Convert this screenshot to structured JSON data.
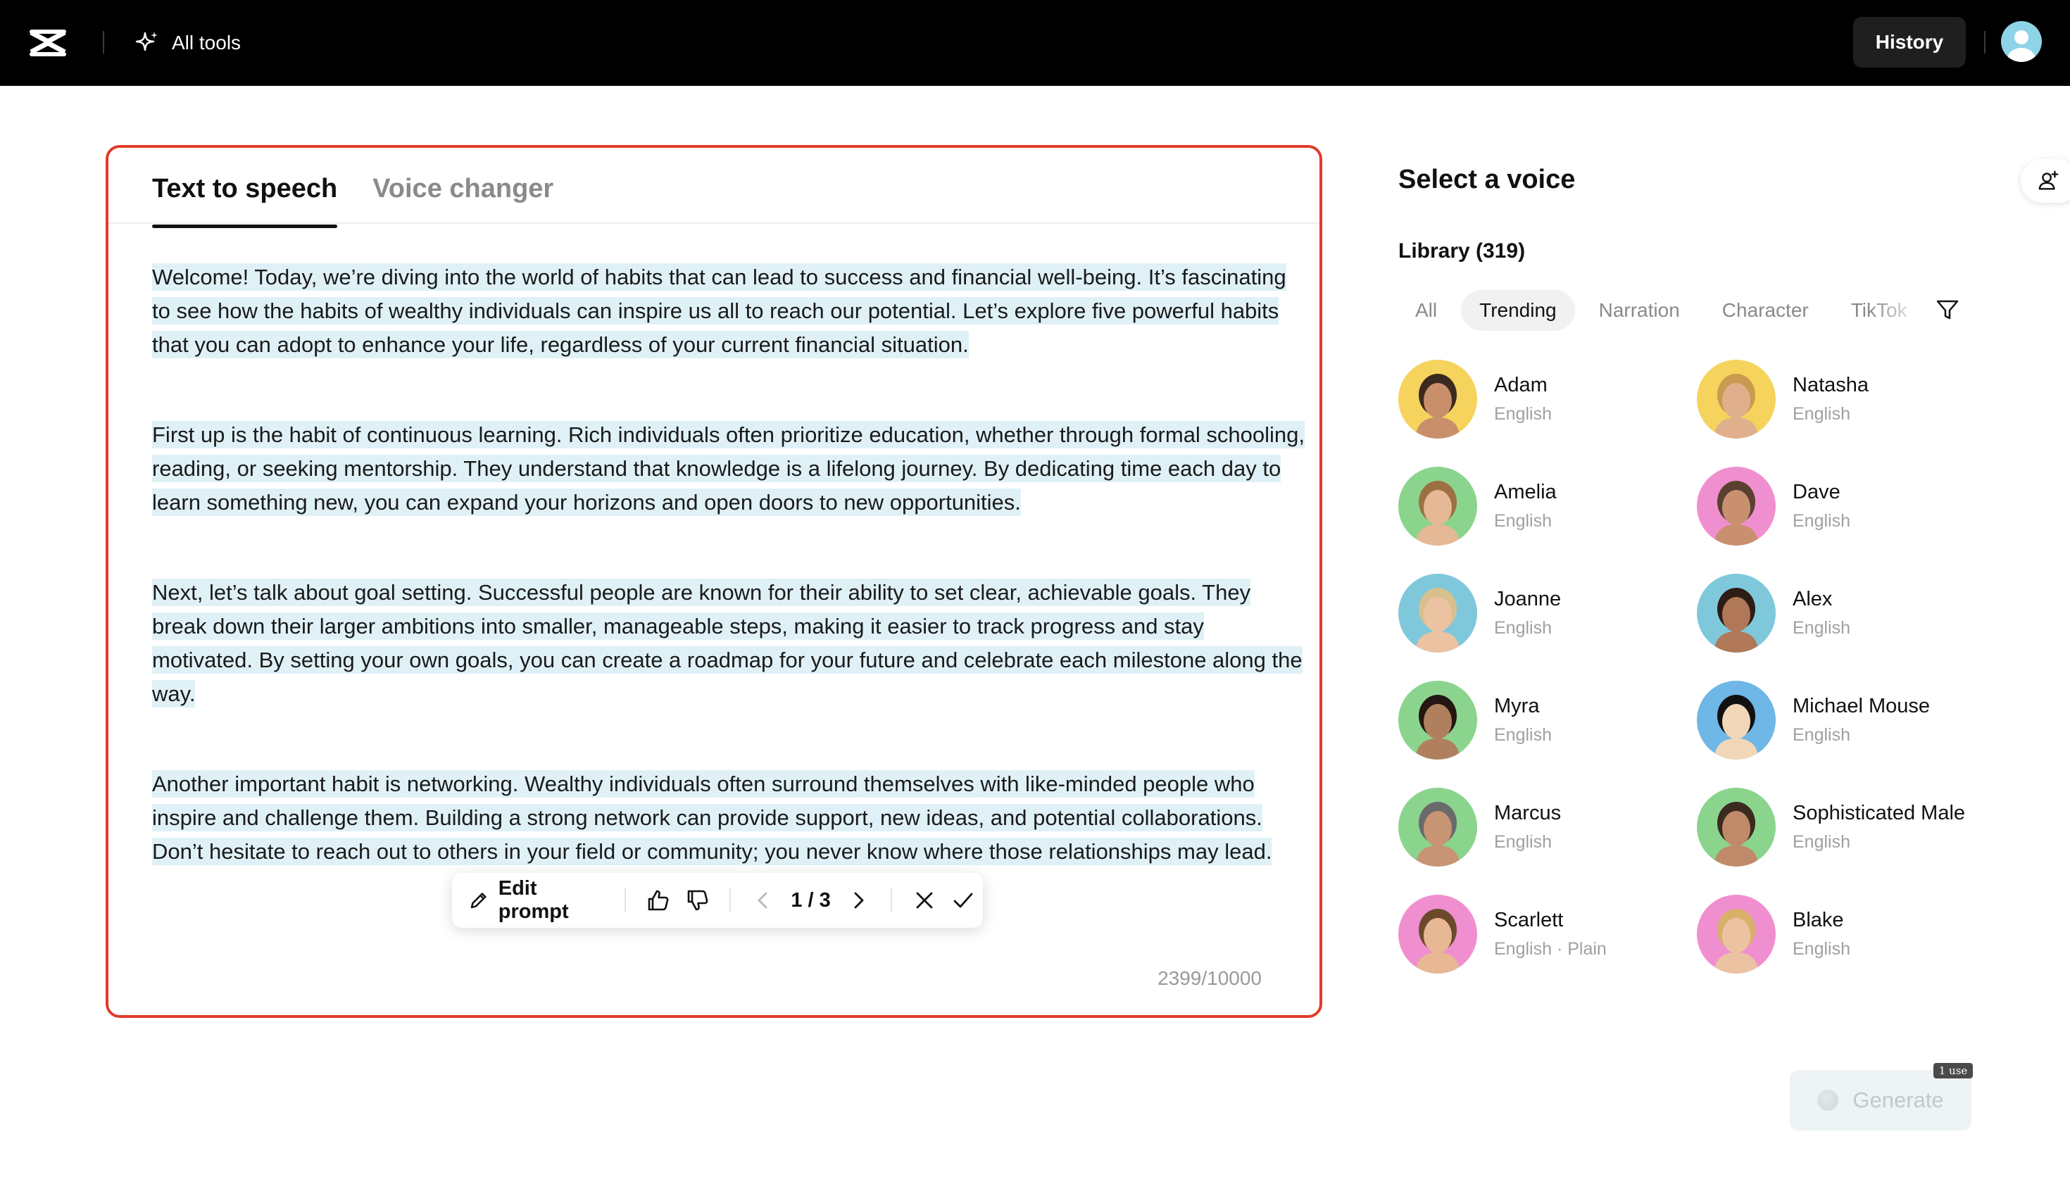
{
  "topbar": {
    "all_tools_label": "All tools",
    "history_label": "History"
  },
  "editor": {
    "tabs": [
      {
        "label": "Text to speech",
        "active": true
      },
      {
        "label": "Voice changer",
        "active": false
      }
    ],
    "paragraphs": [
      "Welcome! Today, we’re diving into the world of habits that can lead to success and financial well-being. It’s fascinating to see how the habits of wealthy individuals can inspire us all to reach our potential. Let’s explore five powerful habits that you can adopt to enhance your life, regardless of your current financial situation.",
      "First up is the habit of continuous learning. Rich individuals often prioritize education, whether through formal schooling, reading, or seeking mentorship. They understand that knowledge is a lifelong journey. By dedicating time each day to learn something new, you can expand your horizons and open doors to new opportunities.",
      "Next, let’s talk about goal setting. Successful people are known for their ability to set clear, achievable goals. They break down their larger ambitions into smaller, manageable steps, making it easier to track progress and stay motivated. By setting your own goals, you can create a roadmap for your future and celebrate each milestone along the way.",
      "Another important habit is networking. Wealthy individuals often surround themselves with like-minded people who inspire and challenge them. Building a strong network can provide support, new ideas, and potential collaborations. Don’t hesitate to reach out to others in your field or community; you never know where those relationships may lead."
    ],
    "char_count": "2399/10000",
    "toolbar": {
      "edit_prompt_label": "Edit prompt",
      "page_indicator": "1 / 3"
    }
  },
  "voice_panel": {
    "title": "Select a voice",
    "library_label": "Library (319)",
    "filters": [
      {
        "label": "All",
        "active": false
      },
      {
        "label": "Trending",
        "active": true
      },
      {
        "label": "Narration",
        "active": false
      },
      {
        "label": "Character",
        "active": false
      },
      {
        "label": "TikTok",
        "active": false
      }
    ],
    "voices": [
      {
        "name": "Adam",
        "lang": "English",
        "bg": "#f5d35c",
        "skin": "#c98f6b",
        "hair": "#3b2a1f"
      },
      {
        "name": "Natasha",
        "lang": "English",
        "bg": "#f5d35c",
        "skin": "#e0b08c",
        "hair": "#c99a4f"
      },
      {
        "name": "Amelia",
        "lang": "English",
        "bg": "#8bd48e",
        "skin": "#e5b896",
        "hair": "#9c7040"
      },
      {
        "name": "Dave",
        "lang": "English",
        "bg": "#f08fcf",
        "skin": "#c99070",
        "hair": "#5a4030"
      },
      {
        "name": "Joanne",
        "lang": "English",
        "bg": "#7fc8dc",
        "skin": "#ecc3a2",
        "hair": "#d8c08e"
      },
      {
        "name": "Alex",
        "lang": "English",
        "bg": "#7fc8dc",
        "skin": "#b07858",
        "hair": "#2d1d14"
      },
      {
        "name": "Myra",
        "lang": "English",
        "bg": "#8bd48e",
        "skin": "#b0805e",
        "hair": "#241612"
      },
      {
        "name": "Michael Mouse",
        "lang": "English",
        "bg": "#6fb7e6",
        "skin": "#f2d6b8",
        "hair": "#111111"
      },
      {
        "name": "Marcus",
        "lang": "English",
        "bg": "#8bd48e",
        "skin": "#c79474",
        "hair": "#6a6a6a"
      },
      {
        "name": "Sophisticated Male",
        "lang": "English",
        "bg": "#8bd48e",
        "skin": "#c08a6a",
        "hair": "#3a2a20"
      },
      {
        "name": "Scarlett",
        "lang": "English · Plain",
        "bg": "#f08fcf",
        "skin": "#e8b894",
        "hair": "#6b4a2c"
      },
      {
        "name": "Blake",
        "lang": "English",
        "bg": "#f08fcf",
        "skin": "#ecc3a2",
        "hair": "#d9b06a"
      }
    ],
    "generate_label": "Generate",
    "usage_badge": "1 use"
  }
}
